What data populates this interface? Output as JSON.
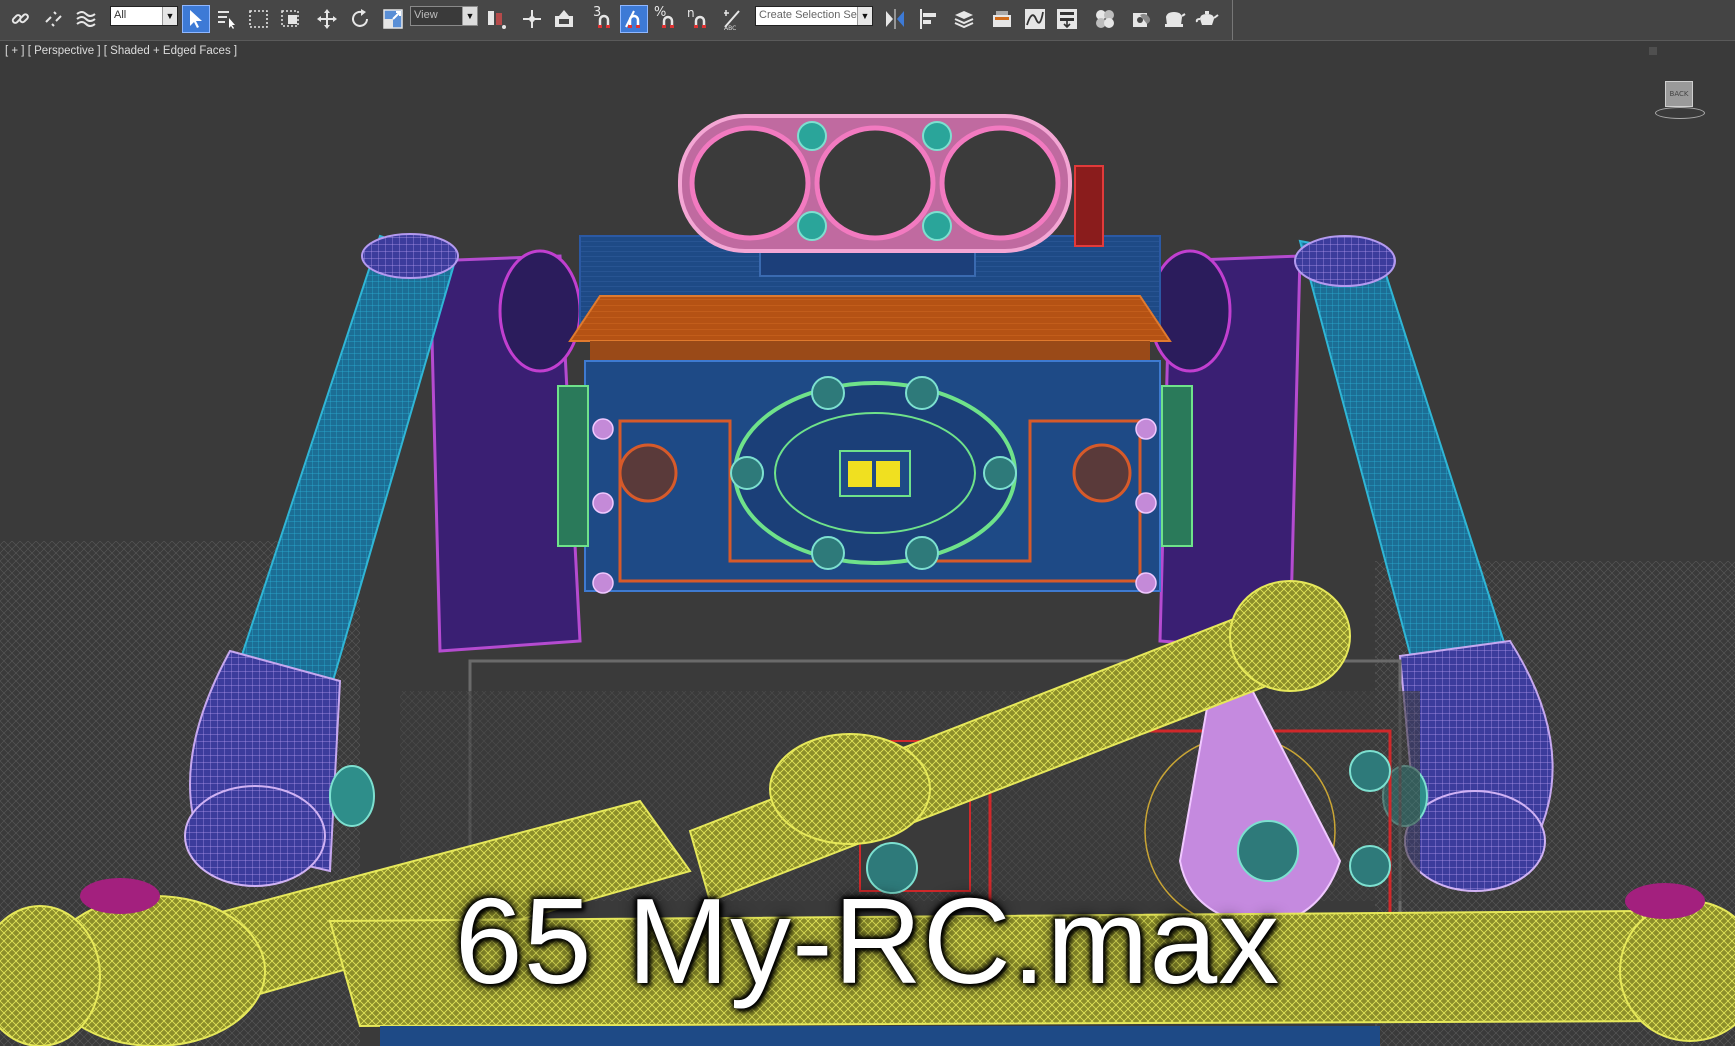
{
  "toolbar": {
    "selection_filter": "All",
    "reference_coord": "View",
    "named_selection_placeholder": "Create Selection Se",
    "snap_toggle_label": "3",
    "percent_snap_label": "%",
    "spinner_snap_label": "n",
    "buttons": [
      {
        "name": "select-and-link",
        "icon": "link-icon"
      },
      {
        "name": "unlink-selection",
        "icon": "unlink-icon"
      },
      {
        "name": "bind-to-space-warp",
        "icon": "space-warp-icon"
      },
      {
        "name": "select-object",
        "icon": "select-cursor-icon",
        "active": true
      },
      {
        "name": "select-by-name",
        "icon": "select-by-name-icon"
      },
      {
        "name": "rectangular-selection-region",
        "icon": "rect-region-icon"
      },
      {
        "name": "window-crossing",
        "icon": "window-crossing-icon"
      },
      {
        "name": "select-and-move",
        "icon": "move-icon"
      },
      {
        "name": "select-and-rotate",
        "icon": "rotate-icon"
      },
      {
        "name": "select-and-scale",
        "icon": "scale-icon"
      },
      {
        "name": "select-and-manipulate",
        "icon": "manipulate-icon"
      },
      {
        "name": "use-pivot-point-center",
        "icon": "pivot-icon"
      },
      {
        "name": "keyboard-shortcut-override",
        "icon": "override-icon"
      },
      {
        "name": "snaps-toggle",
        "icon": "snap-3d-icon"
      },
      {
        "name": "angle-snap-toggle",
        "icon": "angle-snap-icon",
        "active": true
      },
      {
        "name": "percent-snap-toggle",
        "icon": "percent-snap-icon"
      },
      {
        "name": "spinner-snap-toggle",
        "icon": "spinner-snap-icon"
      },
      {
        "name": "edit-named-selection-sets",
        "icon": "edit-named-selection-icon"
      },
      {
        "name": "mirror",
        "icon": "mirror-icon"
      },
      {
        "name": "align",
        "icon": "align-icon"
      },
      {
        "name": "layer-explorer",
        "icon": "layers-icon"
      },
      {
        "name": "toggle-ribbon",
        "icon": "ribbon-icon"
      },
      {
        "name": "curve-editor",
        "icon": "curve-editor-icon"
      },
      {
        "name": "schematic-view",
        "icon": "schematic-icon"
      },
      {
        "name": "material-editor",
        "icon": "material-editor-icon"
      },
      {
        "name": "render-setup",
        "icon": "render-setup-icon"
      },
      {
        "name": "rendered-frame-window",
        "icon": "frame-window-icon"
      },
      {
        "name": "render-production",
        "icon": "teapot-icon"
      }
    ]
  },
  "viewport": {
    "label_plus": "[ + ]",
    "label_view": "[ Perspective ]",
    "label_shading": "[ Shaded + Edged Faces ]",
    "viewcube_face": "BACK",
    "file_title": "65 My-RC.max"
  },
  "colors": {
    "toolbar_bg": "#474747",
    "viewport_bg": "#3a3a3a",
    "active_button": "#3d7ad6",
    "wire_pink": "#f4a6d4",
    "wire_blue": "#1e4a86",
    "wire_cyan": "#18a0c2",
    "wire_green": "#6fe28a",
    "wire_orange": "#c85a1a",
    "wire_yellow": "#cfd13c",
    "wire_purple": "#7d6de0",
    "wire_violet": "#d790f2"
  }
}
